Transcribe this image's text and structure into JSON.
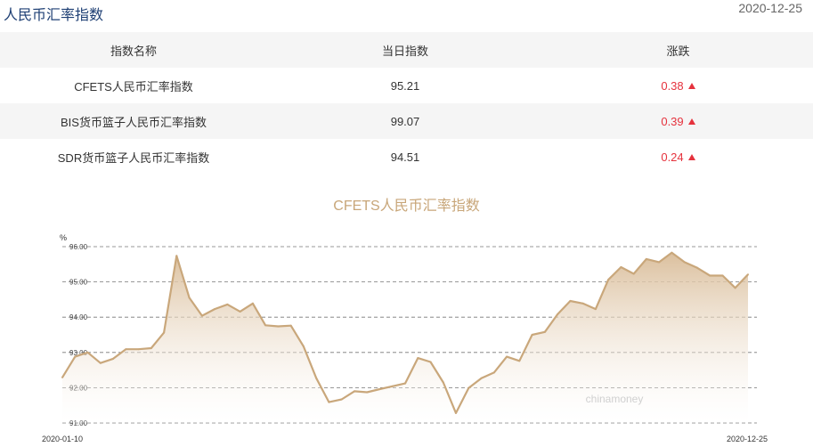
{
  "header": {
    "title": "人民币汇率指数",
    "date": "2020-12-25"
  },
  "table": {
    "headers": [
      "指数名称",
      "当日指数",
      "涨跌"
    ],
    "rows": [
      {
        "name": "CFETS人民币汇率指数",
        "value": "95.21",
        "change": "0.38",
        "direction": "up"
      },
      {
        "name": "BIS货币篮子人民币汇率指数",
        "value": "99.07",
        "change": "0.39",
        "direction": "up"
      },
      {
        "name": "SDR货币篮子人民币汇率指数",
        "value": "94.51",
        "change": "0.24",
        "direction": "up"
      }
    ]
  },
  "colors": {
    "up": "#e5323d",
    "line": "#c9a77b",
    "title_blue": "#1e3f74"
  },
  "chart_data": {
    "type": "area",
    "title": "CFETS人民币汇率指数",
    "ylabel": "%",
    "yticks": [
      "96.00",
      "95.00",
      "94.00",
      "93.00",
      "92.00",
      "91.00"
    ],
    "ylim": [
      91.0,
      96.0
    ],
    "x_start_label": "2020-01-10",
    "x_end_label": "2020-12-25",
    "watermark": "chinamoney",
    "grid": true,
    "series": [
      {
        "values": [
          92.29,
          92.88,
          93.0,
          92.7,
          92.82,
          93.09,
          93.09,
          93.12,
          93.56,
          95.74,
          94.55,
          94.04,
          94.23,
          94.36,
          94.16,
          94.39,
          93.77,
          93.74,
          93.76,
          93.17,
          92.27,
          91.59,
          91.67,
          91.9,
          91.87,
          91.96,
          92.04,
          92.12,
          92.84,
          92.73,
          92.15,
          91.28,
          91.99,
          92.27,
          92.43,
          92.88,
          92.76,
          93.5,
          93.58,
          94.08,
          94.46,
          94.39,
          94.23,
          95.06,
          95.42,
          95.23,
          95.65,
          95.56,
          95.83,
          95.56,
          95.4,
          95.18,
          95.18,
          94.83,
          95.21
        ]
      }
    ]
  }
}
